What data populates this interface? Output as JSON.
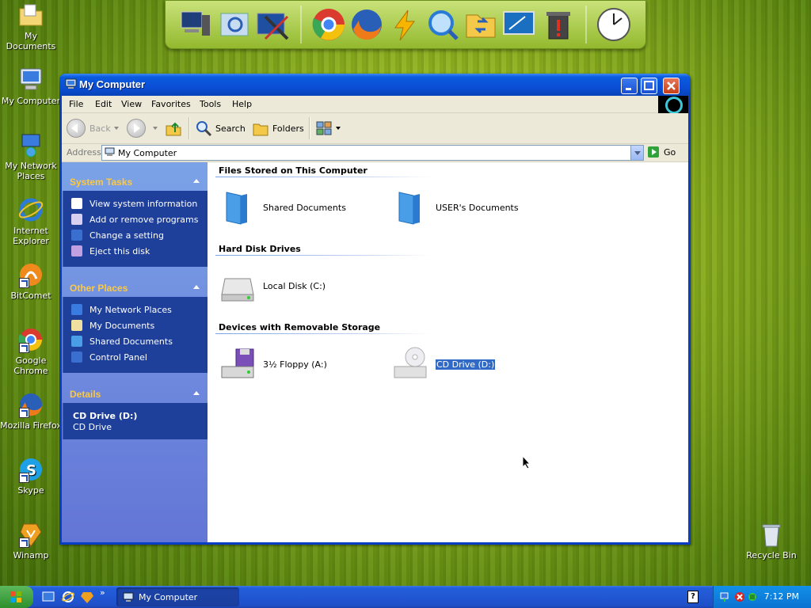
{
  "desktop": {
    "icons": [
      {
        "label": "My Documents"
      },
      {
        "label": "My Computer"
      },
      {
        "label": "My Network Places"
      },
      {
        "label": "Internet Explorer"
      },
      {
        "label": "BitComet"
      },
      {
        "label": "Google Chrome"
      },
      {
        "label": "Mozilla Firefox"
      },
      {
        "label": "Skype"
      },
      {
        "label": "Winamp"
      }
    ],
    "recycle_bin": "Recycle Bin"
  },
  "dock": {
    "items": [
      "computer-icon",
      "search-icon",
      "tools-icon",
      "chrome-icon",
      "firefox-icon",
      "lightning-icon",
      "magnifier-icon",
      "folder-transfer-icon",
      "monitor-icon",
      "trash-icon",
      "clock-icon"
    ]
  },
  "window": {
    "title": "My Computer",
    "menu": [
      "File",
      "Edit",
      "View",
      "Favorites",
      "Tools",
      "Help"
    ],
    "toolbar": {
      "back": "Back",
      "search": "Search",
      "folders": "Folders"
    },
    "address": {
      "label": "Address",
      "value": "My Computer",
      "go": "Go"
    },
    "taskpane": {
      "system_tasks": {
        "title": "System Tasks",
        "items": [
          "View system information",
          "Add or remove programs",
          "Change a setting",
          "Eject this disk"
        ]
      },
      "other_places": {
        "title": "Other Places",
        "items": [
          "My Network Places",
          "My Documents",
          "Shared Documents",
          "Control Panel"
        ]
      },
      "details": {
        "title": "Details",
        "name": "CD Drive (D:)",
        "type": "CD Drive"
      }
    },
    "content": {
      "groups": [
        {
          "title": "Files Stored on This Computer",
          "items": [
            "Shared Documents",
            "USER's Documents"
          ]
        },
        {
          "title": "Hard Disk Drives",
          "items": [
            "Local Disk (C:)"
          ]
        },
        {
          "title": "Devices with Removable Storage",
          "items": [
            "3½ Floppy (A:)",
            "CD Drive (D:)"
          ]
        }
      ]
    }
  },
  "taskbar": {
    "task_button": "My Computer",
    "clock": "7:12 PM",
    "help": "?"
  },
  "colors": {
    "title_blue": "#0a4fd6",
    "task_yellow": "#fec93f",
    "selection": "#316ac5"
  }
}
